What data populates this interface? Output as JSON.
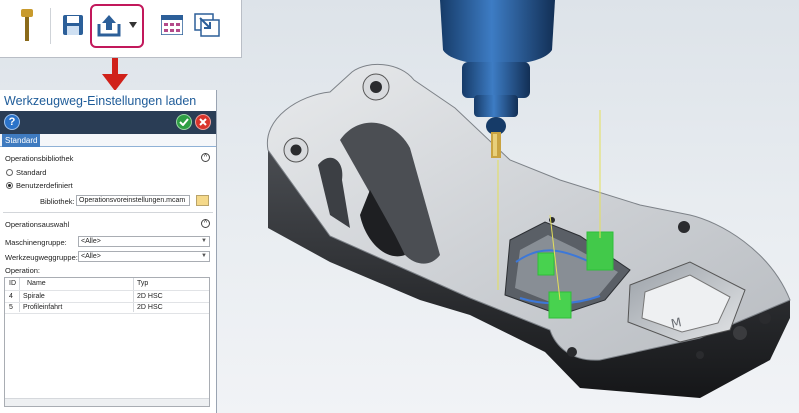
{
  "toolbar": {
    "buttons": [
      {
        "icon": "tool-holder-icon"
      },
      {
        "icon": "save-icon"
      },
      {
        "icon": "export-icon",
        "highlight": "#c2185b"
      },
      {
        "icon": "dropdown-arrow-icon"
      },
      {
        "icon": "operations-grid-icon"
      },
      {
        "icon": "import-icon"
      }
    ]
  },
  "dialog": {
    "title": "Werkzeugweg-Einstellungen laden",
    "help_label": "?",
    "tab_label": "Standard",
    "library_section": {
      "heading": "Operationsbibliothek",
      "option_standard": "Standard",
      "option_custom": "Benutzerdefiniert",
      "selected": "Benutzerdefiniert",
      "library_label": "Bibliothek:",
      "library_value": "Operationsvoreinstellungen.mcam"
    },
    "selection_section": {
      "heading": "Operationsauswahl",
      "machine_group_label": "Maschinengruppe:",
      "machine_group_value": "<Alle>",
      "tool_group_label": "Werkzeugweggruppe:",
      "tool_group_value": "<Alle>",
      "operation_label": "Operation:"
    },
    "table": {
      "headers": [
        "ID",
        "Name",
        "Typ"
      ],
      "rows": [
        {
          "id": "4",
          "name": "Spirale",
          "type": "2D HSC"
        },
        {
          "id": "5",
          "name": "Profileinfahrt",
          "type": "2D HSC"
        }
      ]
    }
  },
  "colors": {
    "title_text": "#1f5c99",
    "panel_bar": "#2a3d55",
    "ok_green": "#2e9e44",
    "cancel_red": "#d9342b",
    "help_blue": "#2b73c9",
    "tab_blue": "#3f7bc0",
    "arrow_red": "#d0211a",
    "toolpath_green": "#2fbf3a",
    "spindle_blue": "#1f4f8a"
  }
}
